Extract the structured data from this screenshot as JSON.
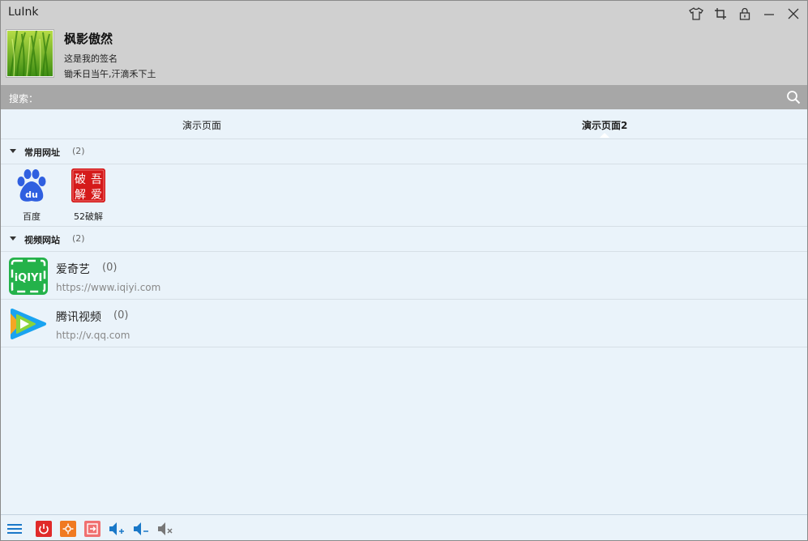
{
  "window": {
    "title": "LuInk"
  },
  "profile": {
    "name": "枫影傲然",
    "signature1": "这是我的签名",
    "signature2": "锄禾日当午,汗滴禾下土"
  },
  "search": {
    "label": "搜索：",
    "placeholder": ""
  },
  "tabs": [
    {
      "label": "演示页面",
      "active": false
    },
    {
      "label": "演示页面2",
      "active": true
    }
  ],
  "groups": [
    {
      "name": "常用网址",
      "count": "(2)",
      "items": [
        {
          "label": "百度",
          "icon": "baidu-icon"
        },
        {
          "label": "52破解",
          "icon": "52pojie-icon"
        }
      ]
    },
    {
      "name": "视频网站",
      "count": "(2)",
      "items": [
        {
          "name": "爱奇艺",
          "count": "(0)",
          "url": "https://www.iqiyi.com",
          "icon": "iqiyi-icon"
        },
        {
          "name": "腾讯视频",
          "count": "(0)",
          "url": "http://v.qq.com",
          "icon": "tencent-video-icon"
        }
      ]
    }
  ],
  "icons": {
    "baidu_text": "du",
    "pojie_chars": [
      "破",
      "吾",
      "解",
      "爱"
    ],
    "iqiyi_text": "iQIYI"
  },
  "colors": {
    "header_bg": "#d0d0d0",
    "search_bg": "#a7a7a7",
    "content_bg": "#eaf3fa",
    "baidu_blue": "#2f5fe0",
    "pojie_red": "#d51a1a",
    "iqiyi_green": "#24b24a",
    "power_red": "#e02a2a",
    "footer_orange": "#f07a22",
    "volume_blue": "#1a78c8"
  }
}
